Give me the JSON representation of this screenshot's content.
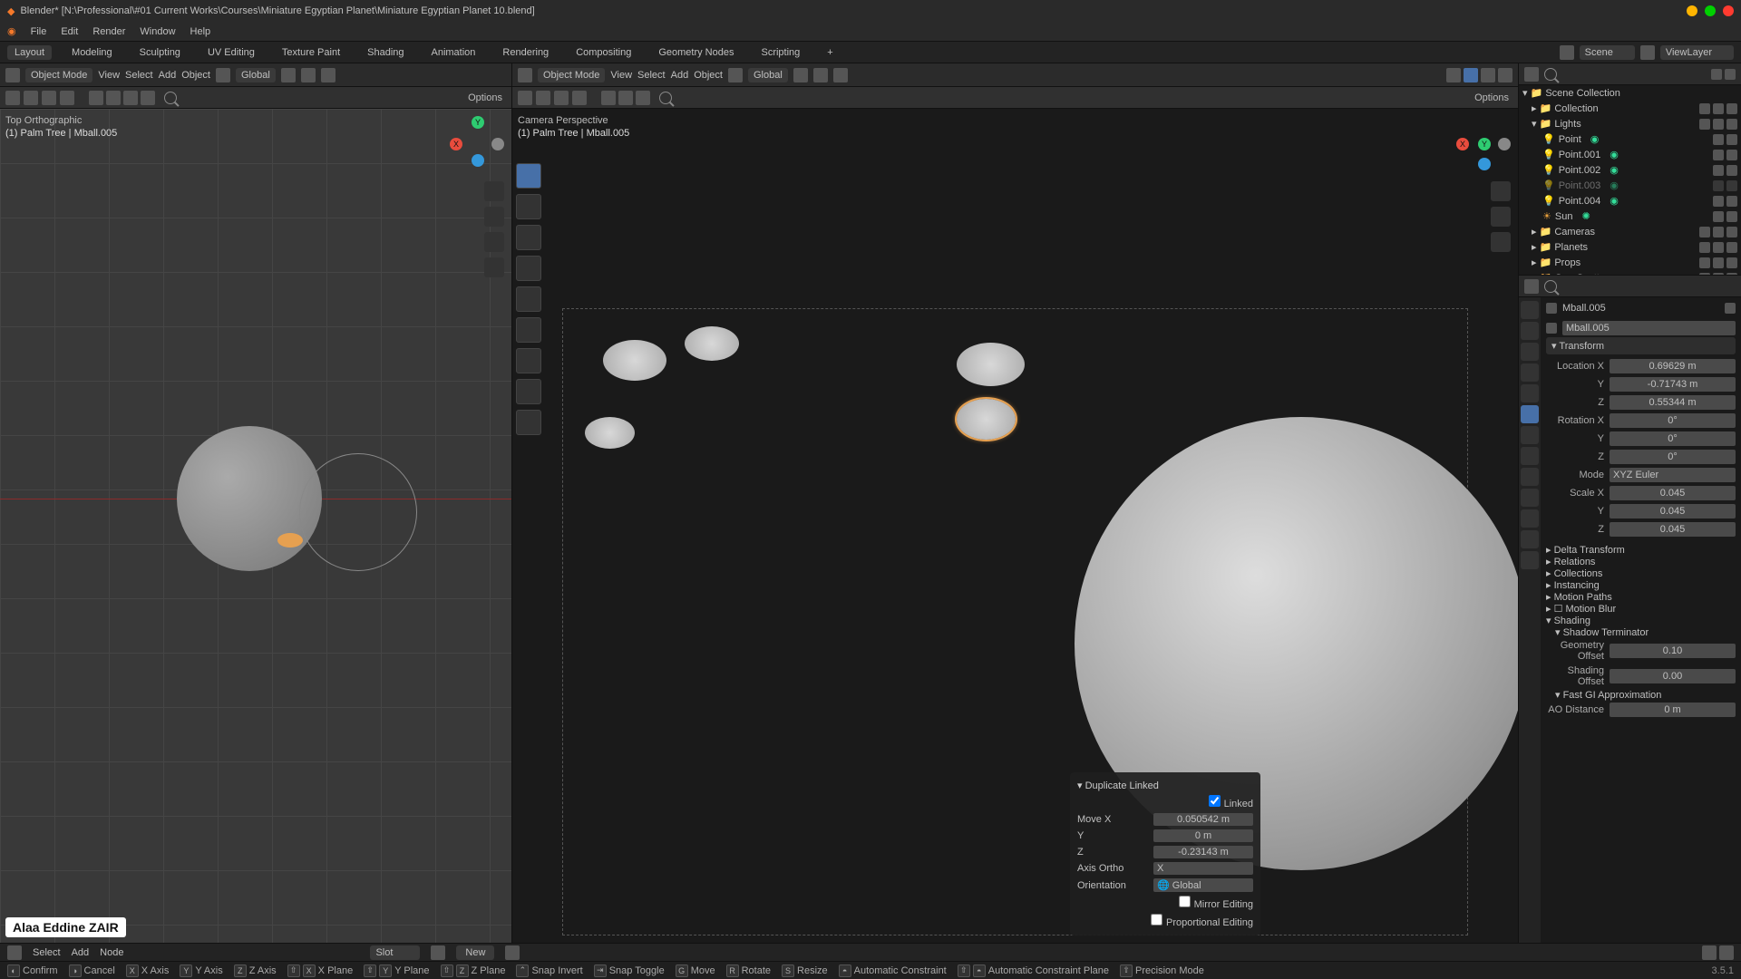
{
  "title": "Blender* [N:\\Professional\\#01 Current Works\\Courses\\Miniature Egyptian Planet\\Miniature Egyptian Planet 10.blend]",
  "menu": [
    "File",
    "Edit",
    "Render",
    "Window",
    "Help"
  ],
  "tabs": [
    "Layout",
    "Modeling",
    "Sculpting",
    "UV Editing",
    "Texture Paint",
    "Shading",
    "Animation",
    "Rendering",
    "Compositing",
    "Geometry Nodes",
    "Scripting"
  ],
  "tab_plus": "+",
  "active_tab": "Layout",
  "scene_label": "Scene",
  "viewlayer_label": "ViewLayer",
  "left_header": {
    "mode": "Object Mode",
    "view": "View",
    "select": "Select",
    "add": "Add",
    "object": "Object",
    "orientation": "Global",
    "options": "Options"
  },
  "right_header": {
    "mode": "Object Mode",
    "view": "View",
    "select": "Select",
    "add": "Add",
    "object": "Object",
    "orientation": "Global",
    "options": "Options"
  },
  "left_overlay": {
    "l1": "Top Orthographic",
    "l2": "(1) Palm Tree | Mball.005"
  },
  "right_overlay": {
    "l1": "Camera Perspective",
    "l2": "(1) Palm Tree | Mball.005"
  },
  "popup": {
    "title": "Duplicate Linked",
    "linked": "Linked",
    "move_x_lab": "Move X",
    "move_x": "0.050542 m",
    "y_lab": "Y",
    "y": "0 m",
    "z_lab": "Z",
    "z": "-0.23143 m",
    "axis_ortho_lab": "Axis Ortho",
    "axis_ortho": "X",
    "orientation_lab": "Orientation",
    "orientation": "Global",
    "mirror": "Mirror Editing",
    "prop": "Proportional Editing"
  },
  "outliner": {
    "root": "Scene Collection",
    "collection": "Collection",
    "lights": "Lights",
    "light_items": [
      "Point",
      "Point.001",
      "Point.002",
      "Point.003",
      "Point.004",
      "Sun"
    ],
    "cameras": "Cameras",
    "planets": "Planets",
    "props": "Props",
    "geoscatter": "Geo-Scatter"
  },
  "props": {
    "object": "Mball.005",
    "data": "Mball.005",
    "transform": "Transform",
    "loc": {
      "x_lab": "Location X",
      "x": "0.69629 m",
      "y_lab": "Y",
      "y": "-0.71743 m",
      "z_lab": "Z",
      "z": "0.55344 m"
    },
    "rot": {
      "x_lab": "Rotation X",
      "x": "0°",
      "y_lab": "Y",
      "y": "0°",
      "z_lab": "Z",
      "z": "0°"
    },
    "rot_mode_lab": "Mode",
    "rot_mode": "XYZ Euler",
    "scale": {
      "x_lab": "Scale X",
      "x": "0.045",
      "y_lab": "Y",
      "y": "0.045",
      "z_lab": "Z",
      "z": "0.045"
    },
    "sections": [
      "Delta Transform",
      "Relations",
      "Collections",
      "Instancing",
      "Motion Paths",
      "Motion Blur"
    ],
    "shading": "Shading",
    "shadow_term": "Shadow Terminator",
    "geo_off_lab": "Geometry Offset",
    "geo_off": "0.10",
    "shad_off_lab": "Shading Offset",
    "shad_off": "0.00",
    "fastgi": "Fast GI Approximation",
    "ao_lab": "AO Distance",
    "ao": "0 m"
  },
  "node_bar": {
    "select": "Select",
    "add": "Add",
    "node": "Node",
    "slot": "Slot",
    "new": "New"
  },
  "status": {
    "confirm": "Confirm",
    "cancel": "Cancel",
    "xaxis": "X Axis",
    "yaxis": "Y Axis",
    "zaxis": "Z Axis",
    "xplane": "X Plane",
    "yplane": "Y Plane",
    "zplane": "Z Plane",
    "snapinv": "Snap Invert",
    "snaptog": "Snap Toggle",
    "move": "Move",
    "rotate": "Rotate",
    "resize": "Resize",
    "autocon": "Automatic Constraint",
    "autoconp": "Automatic Constraint Plane",
    "prec": "Precision Mode",
    "version": "3.5.1"
  },
  "watermark": "Alaa Eddine ZAIR"
}
